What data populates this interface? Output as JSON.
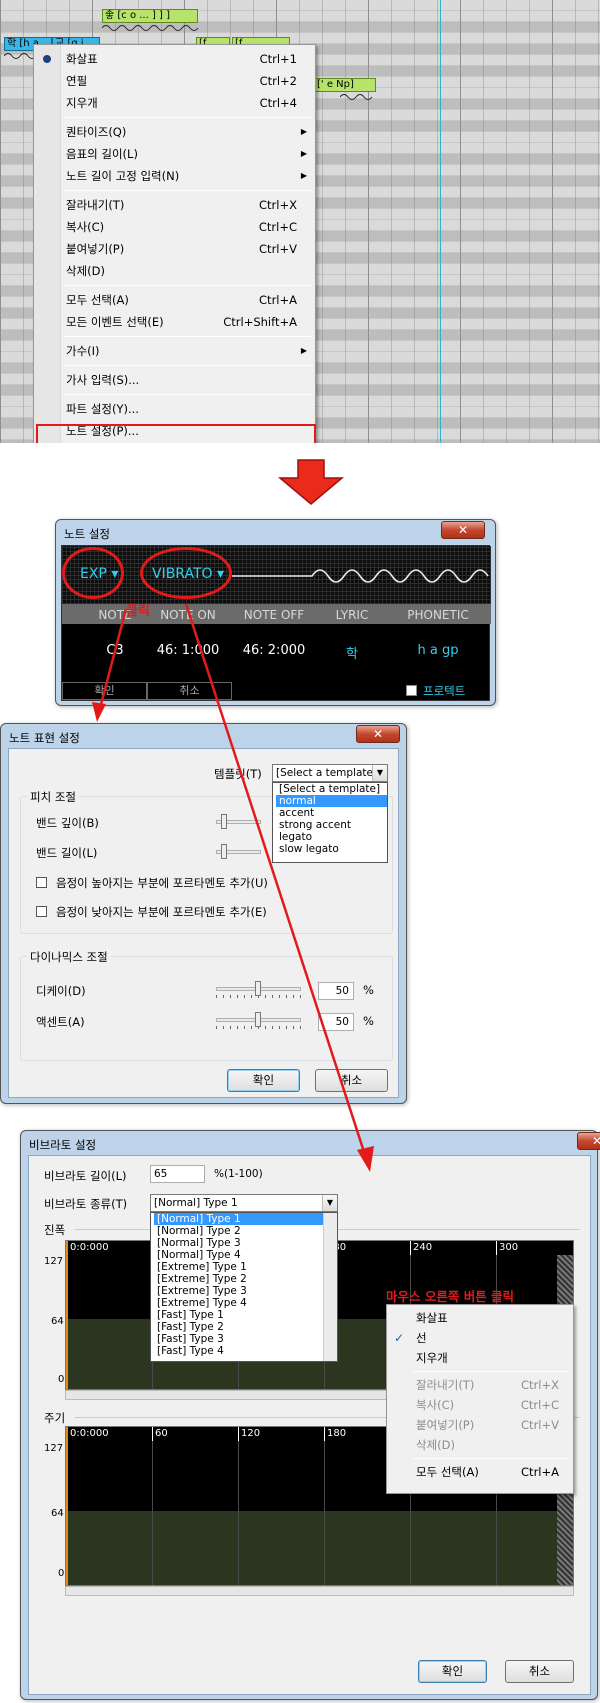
{
  "roll": {
    "notes": [
      {
        "text": "좋 [c o ... ] ] ]",
        "selected": false
      },
      {
        "text": "학 [h a ...",
        "selected": true
      },
      {
        "text": "교 [g j ...",
        "selected": true
      },
      {
        "text": "[f ...",
        "selected": false
      },
      {
        "text": "[f ...",
        "selected": false
      },
      {
        "text": "[' e Np]",
        "selected": false
      }
    ]
  },
  "context_menu": {
    "items": [
      {
        "label": "화살표",
        "shortcut": "Ctrl+1",
        "checked": true
      },
      {
        "label": "연필",
        "shortcut": "Ctrl+2"
      },
      {
        "label": "지우개",
        "shortcut": "Ctrl+4"
      },
      {
        "label": "퀀타이즈(Q)",
        "submenu": true
      },
      {
        "label": "음표의 길이(L)",
        "submenu": true
      },
      {
        "label": "노트 길이 고정 입력(N)",
        "submenu": true
      },
      {
        "label": "잘라내기(T)",
        "shortcut": "Ctrl+X"
      },
      {
        "label": "복사(C)",
        "shortcut": "Ctrl+C"
      },
      {
        "label": "붙여넣기(P)",
        "shortcut": "Ctrl+V"
      },
      {
        "label": "삭제(D)"
      },
      {
        "label": "모두 선택(A)",
        "shortcut": "Ctrl+A"
      },
      {
        "label": "모든 이벤트 선택(E)",
        "shortcut": "Ctrl+Shift+A"
      },
      {
        "label": "가수(I)",
        "submenu": true
      },
      {
        "label": "가사 입력(S)..."
      },
      {
        "label": "파트 설정(Y)..."
      },
      {
        "label": "노트 설정(P)...",
        "highlighted": true
      }
    ]
  },
  "note_dialog": {
    "title": "노트 설정",
    "exp_label": "EXP",
    "vibrato_label": "VIBRATO",
    "headers": [
      "NOTE",
      "NOTE ON",
      "NOTE OFF",
      "LYRIC",
      "PHONETIC"
    ],
    "values": [
      "C3",
      "46: 1:000",
      "46: 2:000",
      "학",
      "h a gp"
    ],
    "ok": "확인",
    "cancel": "취소",
    "protect": "프로텍트",
    "annotation": "클릭"
  },
  "expression_dialog": {
    "title": "노트 표현 설정",
    "template_label": "템플릿(T)",
    "template_value": "[Select a template]",
    "template_options": [
      "[Select a template]",
      "normal",
      "accent",
      "strong accent",
      "legato",
      "slow legato"
    ],
    "template_highlight": 1,
    "pitch_group": "피치 조절",
    "bend_depth": "밴드 깊이(B)",
    "bend_length": "밴드 길이(L)",
    "portamento_up": "음정이 높아지는 부분에 포르타멘토 추가(U)",
    "portamento_down": "음정이 낮아지는 부분에 포르타멘토 추가(E)",
    "dynamics_group": "다이나믹스 조절",
    "decay_label": "디케이(D)",
    "decay_value": "50",
    "accent_label": "액센트(A)",
    "accent_value": "50",
    "unit": "%",
    "ok": "확인",
    "cancel": "취소"
  },
  "vibrato_dialog": {
    "title": "비브라토 설정",
    "length_label": "비브라토 길이(L)",
    "length_value": "65",
    "length_unit": "%(1-100)",
    "type_label": "비브라토 종류(T)",
    "type_value": "[Normal] Type 1",
    "type_options": [
      "[Normal] Type 1",
      "[Normal] Type 2",
      "[Normal] Type 3",
      "[Normal] Type 4",
      "[Extreme] Type 1",
      "[Extreme] Type 2",
      "[Extreme] Type 3",
      "[Extreme] Type 4",
      "[Fast] Type 1",
      "[Fast] Type 2",
      "[Fast] Type 3",
      "[Fast] Type 4"
    ],
    "type_highlight": 0,
    "amplitude_label": "진폭",
    "period_label": "주기",
    "ruler_start": "0:0:000",
    "ruler_ticks": [
      "60",
      "120",
      "180",
      "240",
      "300"
    ],
    "y_labels": [
      "127",
      "64",
      "0"
    ],
    "annotation": "마우스 오른쪽 버튼 클릭",
    "context_items": [
      {
        "label": "화살표"
      },
      {
        "label": "선",
        "checked": true
      },
      {
        "label": "지우개"
      },
      {
        "label": "잘라내기(T)",
        "shortcut": "Ctrl+X",
        "disabled": true
      },
      {
        "label": "복사(C)",
        "shortcut": "Ctrl+C",
        "disabled": true
      },
      {
        "label": "붙여넣기(P)",
        "shortcut": "Ctrl+V",
        "disabled": true
      },
      {
        "label": "삭제(D)",
        "disabled": true
      },
      {
        "label": "모두 선택(A)",
        "shortcut": "Ctrl+A"
      }
    ],
    "ok": "확인",
    "cancel": "취소"
  },
  "colors": {
    "accent_red": "#e21a1a",
    "note_green": "#b7e36a",
    "note_selected": "#39b6e6",
    "vst_cyan": "#2fd0ee"
  }
}
